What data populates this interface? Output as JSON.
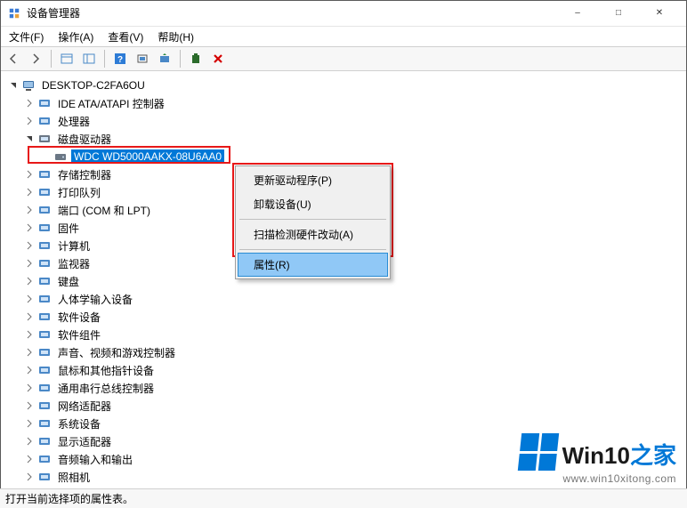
{
  "window": {
    "title": "设备管理器"
  },
  "menu": {
    "file": "文件(F)",
    "action": "操作(A)",
    "view": "查看(V)",
    "help": "帮助(H)"
  },
  "tree": {
    "root": "DESKTOP-C2FA6OU",
    "items": [
      {
        "label": "IDE ATA/ATAPI 控制器",
        "expanded": false
      },
      {
        "label": "处理器",
        "expanded": false
      },
      {
        "label": "磁盘驱动器",
        "expanded": true,
        "children": [
          {
            "label": "WDC WD5000AAKX-08U6AA0",
            "selected": true
          }
        ]
      },
      {
        "label": "存储控制器",
        "expanded": false
      },
      {
        "label": "打印队列",
        "expanded": false
      },
      {
        "label": "端口 (COM 和 LPT)",
        "expanded": false
      },
      {
        "label": "固件",
        "expanded": false
      },
      {
        "label": "计算机",
        "expanded": false
      },
      {
        "label": "监视器",
        "expanded": false
      },
      {
        "label": "键盘",
        "expanded": false
      },
      {
        "label": "人体学输入设备",
        "expanded": false
      },
      {
        "label": "软件设备",
        "expanded": false
      },
      {
        "label": "软件组件",
        "expanded": false
      },
      {
        "label": "声音、视频和游戏控制器",
        "expanded": false
      },
      {
        "label": "鼠标和其他指针设备",
        "expanded": false
      },
      {
        "label": "通用串行总线控制器",
        "expanded": false
      },
      {
        "label": "网络适配器",
        "expanded": false
      },
      {
        "label": "系统设备",
        "expanded": false
      },
      {
        "label": "显示适配器",
        "expanded": false
      },
      {
        "label": "音频输入和输出",
        "expanded": false
      },
      {
        "label": "照相机",
        "expanded": false
      }
    ]
  },
  "context_menu": {
    "update_driver": "更新驱动程序(P)",
    "uninstall": "卸载设备(U)",
    "scan": "扫描检测硬件改动(A)",
    "properties": "属性(R)"
  },
  "status": "打开当前选择项的属性表。",
  "watermark": {
    "brand_prefix": "Win10",
    "brand_suffix": "之家",
    "url": "www.win10xitong.com"
  }
}
